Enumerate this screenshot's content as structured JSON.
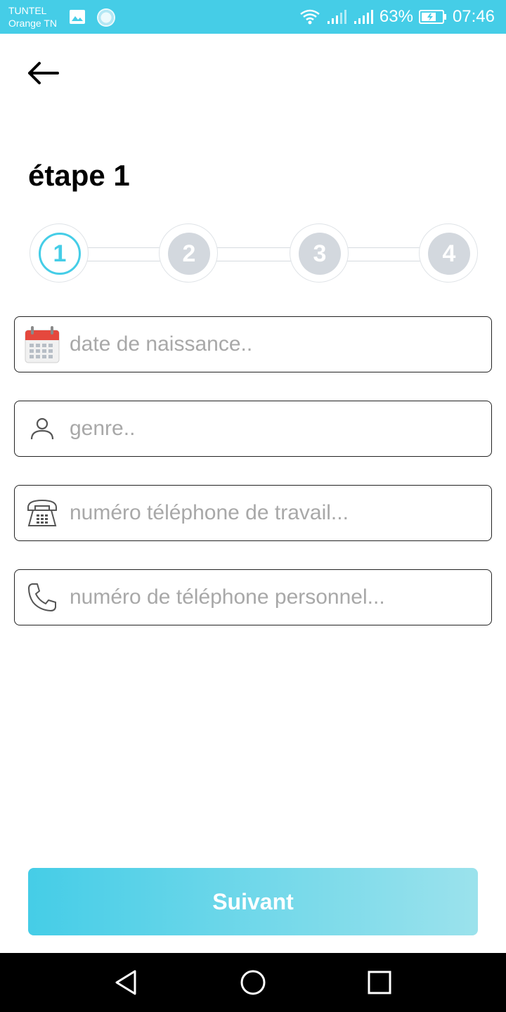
{
  "status_bar": {
    "carrier_line1": "TUNTEL",
    "carrier_line2": "Orange TN",
    "battery": "63%",
    "time": "07:46",
    "icons": [
      "image-icon",
      "loading-icon",
      "wifi-icon",
      "signal-icon",
      "signal-icon",
      "battery-icon"
    ]
  },
  "header": {
    "back_icon": "arrow-left-icon",
    "title": "étape 1"
  },
  "stepper": {
    "steps": [
      "1",
      "2",
      "3",
      "4"
    ],
    "active_index": 0
  },
  "form": {
    "fields": [
      {
        "icon": "calendar-icon",
        "placeholder": "date de naissance..",
        "value": ""
      },
      {
        "icon": "person-icon",
        "placeholder": "genre..",
        "value": ""
      },
      {
        "icon": "desk-phone-icon",
        "placeholder": "numéro téléphone de travail...",
        "value": ""
      },
      {
        "icon": "phone-icon",
        "placeholder": "numéro de téléphone personnel...",
        "value": ""
      }
    ]
  },
  "next_button": {
    "label": "Suivant"
  },
  "nav_bar": {
    "buttons": [
      "back-triangle-icon",
      "home-circle-icon",
      "recents-square-icon"
    ]
  },
  "colors": {
    "accent": "#45cde7",
    "inactive_step": "#d3d8de",
    "placeholder": "#a8a8a8"
  }
}
